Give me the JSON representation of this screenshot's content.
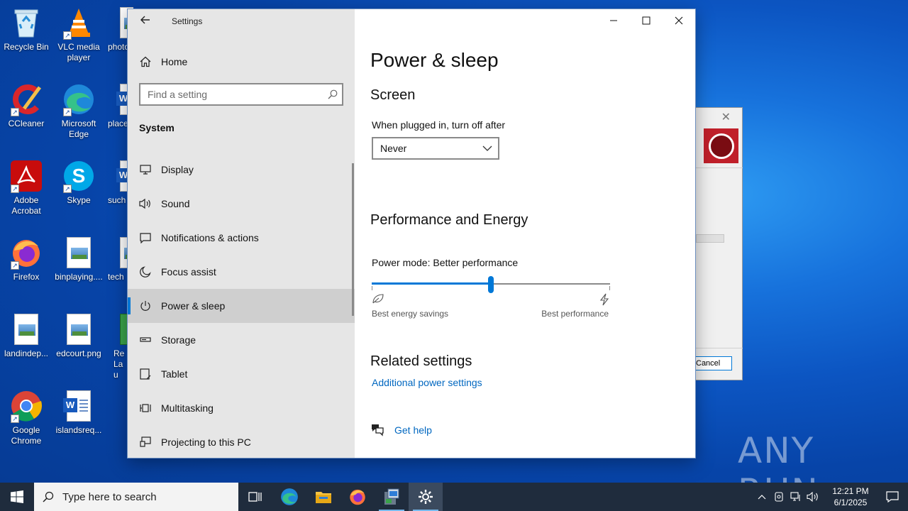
{
  "desktop": {
    "icons": [
      {
        "label": "Recycle Bin"
      },
      {
        "label": "VLC media player"
      },
      {
        "label": "photo"
      },
      {
        "label": "CCleaner"
      },
      {
        "label": "Microsoft Edge"
      },
      {
        "label": "place"
      },
      {
        "label": "Adobe Acrobat"
      },
      {
        "label": "Skype"
      },
      {
        "label": "such"
      },
      {
        "label": "Firefox"
      },
      {
        "label": "binplaying...."
      },
      {
        "label": "tech"
      },
      {
        "label": "landindep..."
      },
      {
        "label": "edcourt.png"
      },
      {
        "label": "Re Lau"
      },
      {
        "label": "Google Chrome"
      },
      {
        "label": "islandsreq..."
      }
    ],
    "watermark": "ANY RUN"
  },
  "background_dialog": {
    "cancel_label": "Cancel"
  },
  "settings": {
    "window_title": "Settings",
    "home_label": "Home",
    "search_placeholder": "Find a setting",
    "section_label": "System",
    "nav_items": [
      {
        "label": "Display",
        "icon": "monitor-icon"
      },
      {
        "label": "Sound",
        "icon": "speaker-icon"
      },
      {
        "label": "Notifications & actions",
        "icon": "message-icon"
      },
      {
        "label": "Focus assist",
        "icon": "moon-icon"
      },
      {
        "label": "Power & sleep",
        "icon": "power-icon",
        "active": true
      },
      {
        "label": "Storage",
        "icon": "storage-icon"
      },
      {
        "label": "Tablet",
        "icon": "tablet-icon"
      },
      {
        "label": "Multitasking",
        "icon": "multitasking-icon"
      },
      {
        "label": "Projecting to this PC",
        "icon": "projecting-icon"
      }
    ],
    "page_title": "Power & sleep",
    "screen": {
      "heading": "Screen",
      "plugged_label": "When plugged in, turn off after",
      "plugged_value": "Never"
    },
    "performance": {
      "heading": "Performance and Energy",
      "mode_label": "Power mode: Better performance",
      "slider_level": 0.5,
      "left_label": "Best energy savings",
      "right_label": "Best performance"
    },
    "related": {
      "heading": "Related settings",
      "link": "Additional power settings"
    },
    "help_link": "Get help",
    "accent_color": "#0078d7"
  },
  "taskbar": {
    "search_placeholder": "Type here to search",
    "apps": [
      "task-view-icon",
      "edge-icon",
      "file-explorer-icon",
      "firefox-icon",
      "installer-icon",
      "settings-icon"
    ],
    "time": "12:21 PM",
    "date": "6/1/2025"
  }
}
